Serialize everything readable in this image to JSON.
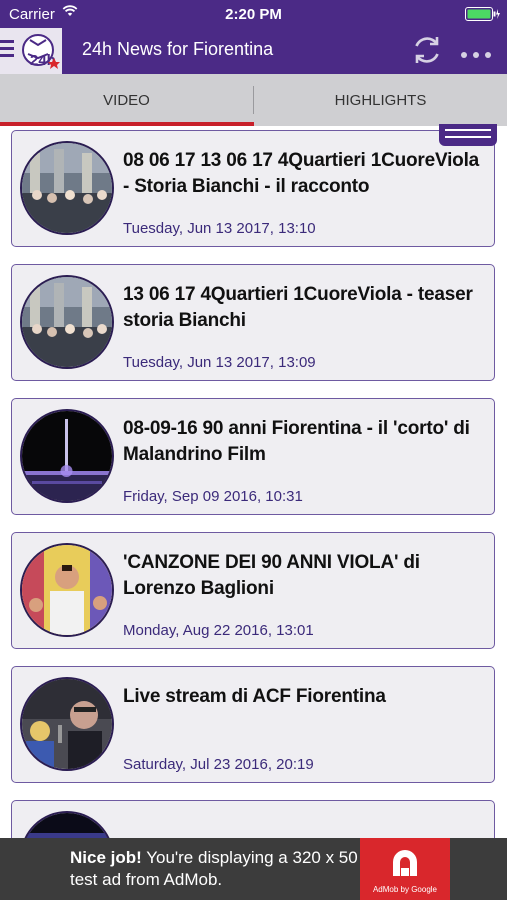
{
  "status_bar": {
    "carrier": "Carrier",
    "time": "2:20 PM"
  },
  "nav": {
    "logo_text": "24h",
    "title": "24h News for Fiorentina"
  },
  "tabs": [
    {
      "label": "VIDEO",
      "selected": true
    },
    {
      "label": "HIGHLIGHTS",
      "selected": false
    }
  ],
  "colors": {
    "brand": "#4b2a86",
    "accent": "#c8202a",
    "date": "#3b2a7a"
  },
  "videos": [
    {
      "title": "08 06 17 13 06 17 4Quartieri 1CuoreViola - Storia Bianchi - il racconto",
      "date": "Tuesday, Jun 13 2017, 13:10",
      "thumb": "crowd-photo"
    },
    {
      "title": "13 06 17 4Quartieri 1CuoreViola - teaser storia Bianchi",
      "date": "Tuesday, Jun 13 2017, 13:09",
      "thumb": "crowd-photo"
    },
    {
      "title": "08-09-16 90 anni Fiorentina - il 'corto' di Malandrino Film",
      "date": "Friday, Sep 09 2016, 10:31",
      "thumb": "stadium-night"
    },
    {
      "title": "'CANZONE DEI 90 ANNI VIOLA' di Lorenzo Baglioni",
      "date": "Monday, Aug 22 2016, 13:01",
      "thumb": "singer"
    },
    {
      "title": "Live stream di ACF Fiorentina",
      "date": "Saturday, Jul 23 2016, 20:19",
      "thumb": "press-conference"
    },
    {
      "title": "",
      "date": "",
      "thumb": "stadium-night"
    }
  ],
  "ad": {
    "headline": "Nice job!",
    "body": " You're displaying a 320 x 50 test ad from AdMob.",
    "brand": "AdMob by Google"
  }
}
